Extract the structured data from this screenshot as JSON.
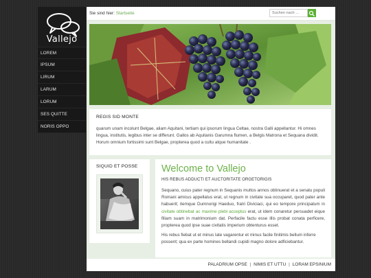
{
  "brand": {
    "name": "Vallejo"
  },
  "nav": {
    "items": [
      {
        "label": "LOREM"
      },
      {
        "label": "IPSUM"
      },
      {
        "label": "LIRUM"
      },
      {
        "label": "LARUM"
      },
      {
        "label": "LORUM"
      },
      {
        "label": "SES QUITTE"
      },
      {
        "label": "NORIS OPPO"
      }
    ]
  },
  "topbar": {
    "crumb_prefix": "Sie sind hier:",
    "crumb_link": "Startseite",
    "search_placeholder": "Suchen nach ..."
  },
  "box1": {
    "title": "REGIS SID MONTE",
    "text": "quarum unam incolunt Belgae, aliam Aquitani, tertiam qui ipsorum lingua Celtae, nostra Galli appellantur. Hi omnes lingua, institutis, legibus inter se differunt. Gallos ab Aquitanis Garumna flumen, a Belgis Matrona et Sequana dividit. Horum omnium fortissimi sunt Belgae, propterea quod a cultu atque humanitate ."
  },
  "box2": {
    "title": "SIQUID ET POSSE"
  },
  "main": {
    "heading": "Welcome to Vallejo",
    "subheading": "HIS REBUS ADDUCTI ET AUCTORITATE ORGETORIGIS",
    "para1_a": "Sequano, cuius pater regnum in Sequanis multos annos obtinuerat et a senatu populi Romani amicus appellatus erat, ut regnum in civitate sua occuparet, quod pater ante habuerit; itemque Dumnorigi Haeduo, fratri Diviciaci, qui eo tempore principatum in",
    "para1_link": "civitate obtinebat ac maxime plebi acceptus",
    "para1_b": " erat, ut idem conaretur persuadet eique filiam suam in matrimonium dat. Perfacile factu esse illis probat conata perficere, propterea quod ipse suae civitatis imperium obtenturus esset.",
    "para2": "His rebus fiebat ut et minus late vagarentur et minus facile finitimis bellum inferre possent; qua ex parte homines bellandi cupidi magno dolore adficiebantur."
  },
  "footer": {
    "links": [
      "PALADRIUM OPSE",
      "NIMIS ET UTTU",
      "LORAM EPSINIUM"
    ],
    "separator": "|"
  },
  "colors": {
    "accent": "#6db14a",
    "sidebar": "#1b1b1b",
    "page_bg": "#e7efe4"
  }
}
